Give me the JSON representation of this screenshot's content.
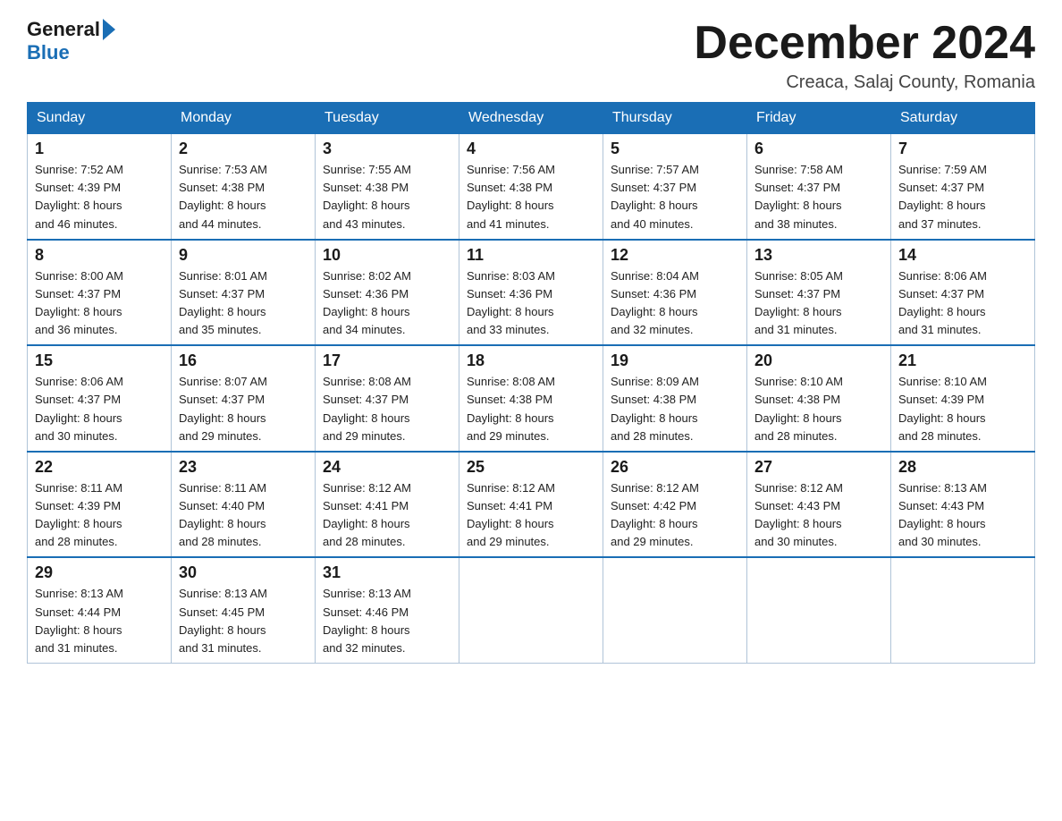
{
  "logo": {
    "general": "General",
    "blue": "Blue"
  },
  "title": "December 2024",
  "subtitle": "Creaca, Salaj County, Romania",
  "headers": [
    "Sunday",
    "Monday",
    "Tuesday",
    "Wednesday",
    "Thursday",
    "Friday",
    "Saturday"
  ],
  "weeks": [
    [
      {
        "day": "1",
        "info": "Sunrise: 7:52 AM\nSunset: 4:39 PM\nDaylight: 8 hours\nand 46 minutes."
      },
      {
        "day": "2",
        "info": "Sunrise: 7:53 AM\nSunset: 4:38 PM\nDaylight: 8 hours\nand 44 minutes."
      },
      {
        "day": "3",
        "info": "Sunrise: 7:55 AM\nSunset: 4:38 PM\nDaylight: 8 hours\nand 43 minutes."
      },
      {
        "day": "4",
        "info": "Sunrise: 7:56 AM\nSunset: 4:38 PM\nDaylight: 8 hours\nand 41 minutes."
      },
      {
        "day": "5",
        "info": "Sunrise: 7:57 AM\nSunset: 4:37 PM\nDaylight: 8 hours\nand 40 minutes."
      },
      {
        "day": "6",
        "info": "Sunrise: 7:58 AM\nSunset: 4:37 PM\nDaylight: 8 hours\nand 38 minutes."
      },
      {
        "day": "7",
        "info": "Sunrise: 7:59 AM\nSunset: 4:37 PM\nDaylight: 8 hours\nand 37 minutes."
      }
    ],
    [
      {
        "day": "8",
        "info": "Sunrise: 8:00 AM\nSunset: 4:37 PM\nDaylight: 8 hours\nand 36 minutes."
      },
      {
        "day": "9",
        "info": "Sunrise: 8:01 AM\nSunset: 4:37 PM\nDaylight: 8 hours\nand 35 minutes."
      },
      {
        "day": "10",
        "info": "Sunrise: 8:02 AM\nSunset: 4:36 PM\nDaylight: 8 hours\nand 34 minutes."
      },
      {
        "day": "11",
        "info": "Sunrise: 8:03 AM\nSunset: 4:36 PM\nDaylight: 8 hours\nand 33 minutes."
      },
      {
        "day": "12",
        "info": "Sunrise: 8:04 AM\nSunset: 4:36 PM\nDaylight: 8 hours\nand 32 minutes."
      },
      {
        "day": "13",
        "info": "Sunrise: 8:05 AM\nSunset: 4:37 PM\nDaylight: 8 hours\nand 31 minutes."
      },
      {
        "day": "14",
        "info": "Sunrise: 8:06 AM\nSunset: 4:37 PM\nDaylight: 8 hours\nand 31 minutes."
      }
    ],
    [
      {
        "day": "15",
        "info": "Sunrise: 8:06 AM\nSunset: 4:37 PM\nDaylight: 8 hours\nand 30 minutes."
      },
      {
        "day": "16",
        "info": "Sunrise: 8:07 AM\nSunset: 4:37 PM\nDaylight: 8 hours\nand 29 minutes."
      },
      {
        "day": "17",
        "info": "Sunrise: 8:08 AM\nSunset: 4:37 PM\nDaylight: 8 hours\nand 29 minutes."
      },
      {
        "day": "18",
        "info": "Sunrise: 8:08 AM\nSunset: 4:38 PM\nDaylight: 8 hours\nand 29 minutes."
      },
      {
        "day": "19",
        "info": "Sunrise: 8:09 AM\nSunset: 4:38 PM\nDaylight: 8 hours\nand 28 minutes."
      },
      {
        "day": "20",
        "info": "Sunrise: 8:10 AM\nSunset: 4:38 PM\nDaylight: 8 hours\nand 28 minutes."
      },
      {
        "day": "21",
        "info": "Sunrise: 8:10 AM\nSunset: 4:39 PM\nDaylight: 8 hours\nand 28 minutes."
      }
    ],
    [
      {
        "day": "22",
        "info": "Sunrise: 8:11 AM\nSunset: 4:39 PM\nDaylight: 8 hours\nand 28 minutes."
      },
      {
        "day": "23",
        "info": "Sunrise: 8:11 AM\nSunset: 4:40 PM\nDaylight: 8 hours\nand 28 minutes."
      },
      {
        "day": "24",
        "info": "Sunrise: 8:12 AM\nSunset: 4:41 PM\nDaylight: 8 hours\nand 28 minutes."
      },
      {
        "day": "25",
        "info": "Sunrise: 8:12 AM\nSunset: 4:41 PM\nDaylight: 8 hours\nand 29 minutes."
      },
      {
        "day": "26",
        "info": "Sunrise: 8:12 AM\nSunset: 4:42 PM\nDaylight: 8 hours\nand 29 minutes."
      },
      {
        "day": "27",
        "info": "Sunrise: 8:12 AM\nSunset: 4:43 PM\nDaylight: 8 hours\nand 30 minutes."
      },
      {
        "day": "28",
        "info": "Sunrise: 8:13 AM\nSunset: 4:43 PM\nDaylight: 8 hours\nand 30 minutes."
      }
    ],
    [
      {
        "day": "29",
        "info": "Sunrise: 8:13 AM\nSunset: 4:44 PM\nDaylight: 8 hours\nand 31 minutes."
      },
      {
        "day": "30",
        "info": "Sunrise: 8:13 AM\nSunset: 4:45 PM\nDaylight: 8 hours\nand 31 minutes."
      },
      {
        "day": "31",
        "info": "Sunrise: 8:13 AM\nSunset: 4:46 PM\nDaylight: 8 hours\nand 32 minutes."
      },
      {
        "day": "",
        "info": ""
      },
      {
        "day": "",
        "info": ""
      },
      {
        "day": "",
        "info": ""
      },
      {
        "day": "",
        "info": ""
      }
    ]
  ]
}
